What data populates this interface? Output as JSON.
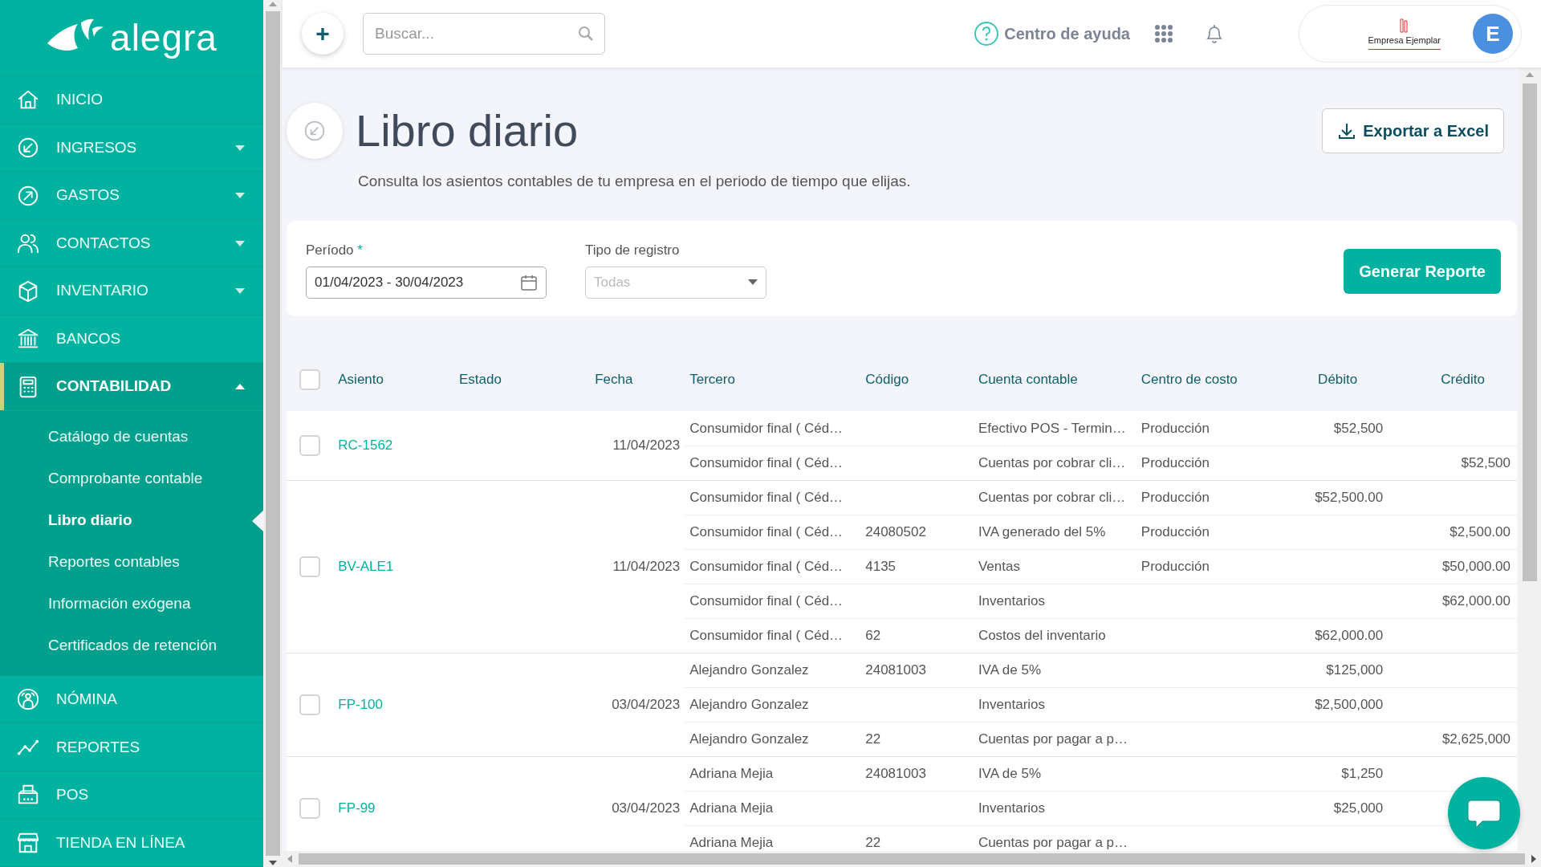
{
  "sidebar": {
    "logo": "alegra",
    "items": [
      {
        "label": "INICIO",
        "selected": false
      },
      {
        "label": "INGRESOS",
        "expanded": false,
        "selected": false
      },
      {
        "label": "GASTOS",
        "expanded": false,
        "selected": false
      },
      {
        "label": "CONTACTOS",
        "expanded": false,
        "selected": false
      },
      {
        "label": "INVENTARIO",
        "expanded": false,
        "selected": false
      },
      {
        "label": "BANCOS",
        "selected": false
      },
      {
        "label": "CONTABILIDAD",
        "expanded": true,
        "selected": true,
        "children": [
          {
            "label": "Catálogo de cuentas",
            "selected": false
          },
          {
            "label": "Comprobante contable",
            "selected": false
          },
          {
            "label": "Libro diario",
            "selected": true
          },
          {
            "label": "Reportes contables",
            "selected": false
          },
          {
            "label": "Información exógena",
            "selected": false
          },
          {
            "label": "Certificados de retención",
            "selected": false
          }
        ]
      },
      {
        "label": "NÓMINA",
        "selected": false
      },
      {
        "label": "REPORTES",
        "selected": false
      },
      {
        "label": "POS",
        "selected": false
      },
      {
        "label": "TIENDA EN LÍNEA",
        "selected": false
      }
    ]
  },
  "header": {
    "add_button": "+",
    "search": {
      "placeholder": "Buscar..."
    },
    "help": "Centro de ayuda",
    "company": "Empresa Ejemplar",
    "avatar": "E"
  },
  "page": {
    "title": "Libro diario",
    "subtitle": "Consulta los asientos contables de tu empresa en el periodo de tiempo que elijas.",
    "export_button": "Exportar a Excel"
  },
  "filters": {
    "period": {
      "label": "Período",
      "required_mark": "*",
      "value": "01/04/2023 - 30/04/2023"
    },
    "type": {
      "label": "Tipo de registro",
      "placeholder": "Todas"
    },
    "submit": "Generar Reporte"
  },
  "table": {
    "columns": [
      "Asiento",
      "Estado",
      "Fecha",
      "Tercero",
      "Código",
      "Cuenta contable",
      "Centro de costo",
      "Débito",
      "Crédito"
    ],
    "header_checked": false,
    "entries": [
      {
        "asiento": "RC-1562",
        "fecha": "11/04/2023",
        "checked": false,
        "lines": [
          {
            "tercero": "Consumidor final ( Céd…",
            "cuenta": "Efectivo POS - Termin…",
            "centro": "Producción",
            "debito": "$52,500"
          },
          {
            "tercero": "Consumidor final ( Céd…",
            "cuenta": "Cuentas por cobrar cli…",
            "centro": "Producción",
            "credito": "$52,500"
          }
        ]
      },
      {
        "asiento": "BV-ALE1",
        "fecha": "11/04/2023",
        "checked": false,
        "lines": [
          {
            "tercero": "Consumidor final ( Céd…",
            "cuenta": "Cuentas por cobrar cli…",
            "centro": "Producción",
            "debito": "$52,500.00"
          },
          {
            "tercero": "Consumidor final ( Céd…",
            "codigo": "24080502",
            "cuenta": "IVA generado del 5%",
            "centro": "Producción",
            "credito": "$2,500.00"
          },
          {
            "tercero": "Consumidor final ( Céd…",
            "codigo": "4135",
            "cuenta": "Ventas",
            "centro": "Producción",
            "credito": "$50,000.00"
          },
          {
            "tercero": "Consumidor final ( Céd…",
            "cuenta": "Inventarios",
            "credito": "$62,000.00"
          },
          {
            "tercero": "Consumidor final ( Céd…",
            "codigo": "62",
            "cuenta": "Costos del inventario",
            "debito": "$62,000.00"
          }
        ]
      },
      {
        "asiento": "FP-100",
        "fecha": "03/04/2023",
        "checked": false,
        "lines": [
          {
            "tercero": "Alejandro Gonzalez",
            "codigo": "24081003",
            "cuenta": "IVA de 5%",
            "debito": "$125,000"
          },
          {
            "tercero": "Alejandro Gonzalez",
            "cuenta": "Inventarios",
            "debito": "$2,500,000"
          },
          {
            "tercero": "Alejandro Gonzalez",
            "codigo": "22",
            "cuenta": "Cuentas por pagar a p…",
            "credito": "$2,625,000"
          }
        ]
      },
      {
        "asiento": "FP-99",
        "fecha": "03/04/2023",
        "checked": false,
        "lines": [
          {
            "tercero": "Adriana Mejia",
            "codigo": "24081003",
            "cuenta": "IVA de 5%",
            "debito": "$1,250"
          },
          {
            "tercero": "Adriana Mejia",
            "cuenta": "Inventarios",
            "debito": "$25,000"
          },
          {
            "tercero": "Adriana Mejia",
            "codigo": "22",
            "cuenta": "Cuentas por pagar a p…"
          }
        ]
      }
    ]
  }
}
